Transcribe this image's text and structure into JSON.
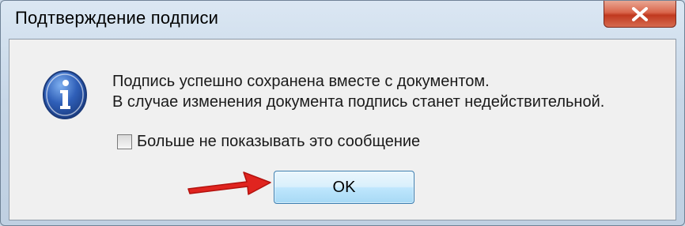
{
  "window": {
    "title": "Подтверждение подписи"
  },
  "dialog": {
    "icon": "info-icon",
    "message_line1": "Подпись успешно сохранена вместе с документом.",
    "message_line2": "В случае изменения документа подпись станет недействительной.",
    "checkbox_label": "Больше не показывать это сообщение",
    "checkbox_checked": false,
    "ok_label": "OK"
  },
  "colors": {
    "close_button": "#c94a2f",
    "info_icon": "#2f5fb8",
    "arrow": "#e0241f",
    "ok_border": "#3c7fb1"
  }
}
